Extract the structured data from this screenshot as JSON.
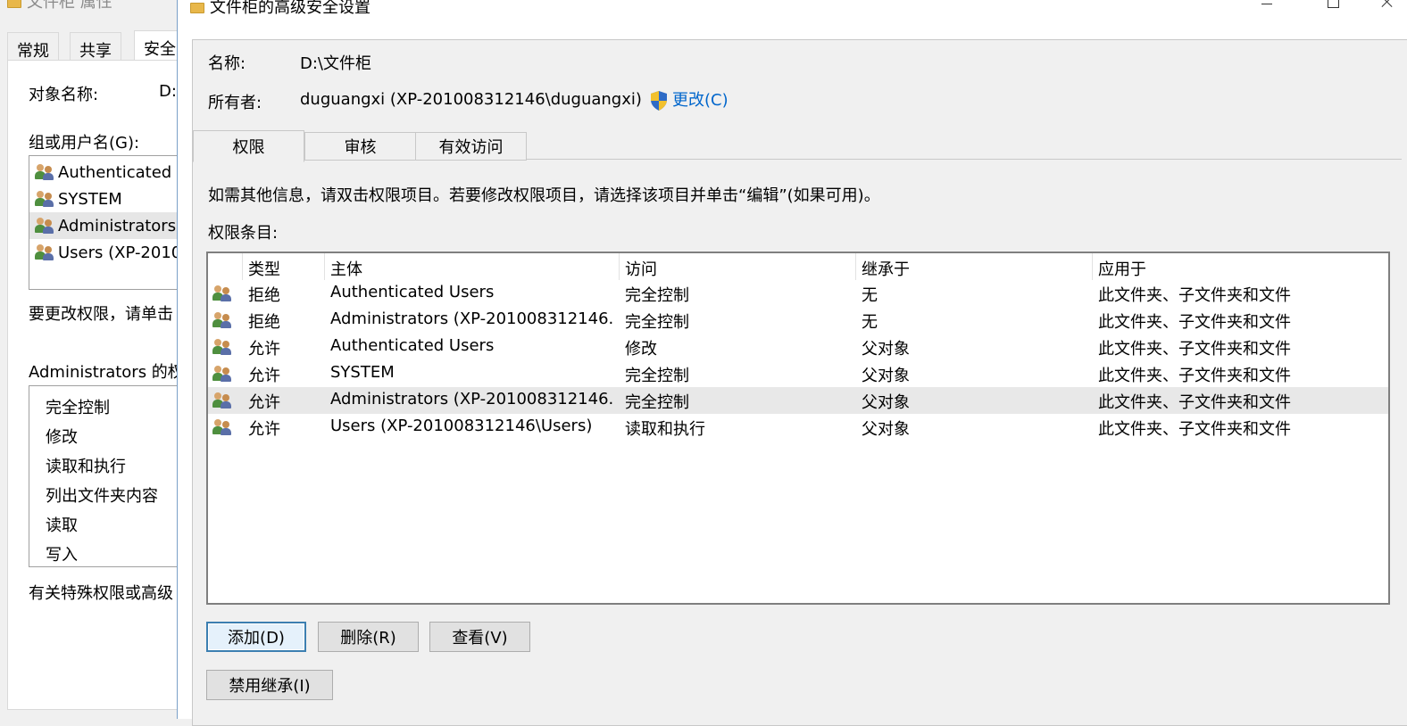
{
  "properties_dialog": {
    "title": "文件柜 属性",
    "tabs": [
      "常规",
      "共享",
      "安全"
    ],
    "object_name_label": "对象名称:",
    "object_name_value": "D:",
    "group_label": "组或用户名(G):",
    "groups": [
      "Authenticated U",
      "SYSTEM",
      "Administrators",
      "Users (XP-2010"
    ],
    "change_hint": "要更改权限，请单击",
    "perm_for_label": "Administrators 的权",
    "permissions": [
      "完全控制",
      "修改",
      "读取和执行",
      "列出文件夹内容",
      "读取",
      "写入"
    ],
    "special_hint": "有关特殊权限或高级"
  },
  "advanced_dialog": {
    "title": "文件柜的高级安全设置",
    "name_label": "名称:",
    "name_value": "D:\\文件柜",
    "owner_label": "所有者:",
    "owner_value": "duguangxi (XP-201008312146\\duguangxi)",
    "change_link": "更改(C)",
    "tabs": [
      "权限",
      "审核",
      "有效访问"
    ],
    "info_text": "如需其他信息，请双击权限项目。若要修改权限项目，请选择该项目并单击“编辑”(如果可用)。",
    "entries_label": "权限条目:",
    "table": {
      "columns": [
        "类型",
        "主体",
        "访问",
        "继承于",
        "应用于"
      ],
      "rows": [
        {
          "type": "拒绝",
          "principal": "Authenticated Users",
          "access": "完全控制",
          "inherited": "无",
          "applies": "此文件夹、子文件夹和文件"
        },
        {
          "type": "拒绝",
          "principal": "Administrators (XP-201008312146...",
          "access": "完全控制",
          "inherited": "无",
          "applies": "此文件夹、子文件夹和文件"
        },
        {
          "type": "允许",
          "principal": "Authenticated Users",
          "access": "修改",
          "inherited": "父对象",
          "applies": "此文件夹、子文件夹和文件"
        },
        {
          "type": "允许",
          "principal": "SYSTEM",
          "access": "完全控制",
          "inherited": "父对象",
          "applies": "此文件夹、子文件夹和文件"
        },
        {
          "type": "允许",
          "principal": "Administrators (XP-201008312146...",
          "access": "完全控制",
          "inherited": "父对象",
          "applies": "此文件夹、子文件夹和文件"
        },
        {
          "type": "允许",
          "principal": "Users (XP-201008312146\\Users)",
          "access": "读取和执行",
          "inherited": "父对象",
          "applies": "此文件夹、子文件夹和文件"
        }
      ]
    },
    "buttons": {
      "add": "添加(D)",
      "remove": "删除(R)",
      "view": "查看(V)",
      "disable_inheritance": "禁用继承(I)"
    }
  }
}
